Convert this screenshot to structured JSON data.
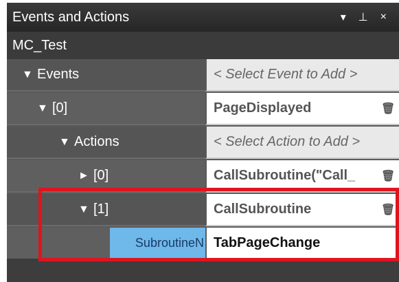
{
  "panel": {
    "title": "Events and Actions",
    "title_buttons": {
      "dropdown": "▾",
      "pin": "⊥",
      "close": "×"
    },
    "subtitle": "MC_Test"
  },
  "tree": {
    "events": {
      "label": "Events",
      "value": "< Select Event to Add >"
    },
    "event0": {
      "label": "[0]",
      "value": "PageDisplayed"
    },
    "actions": {
      "label": "Actions",
      "value": "< Select Action to Add >"
    },
    "action0": {
      "label": "[0]",
      "value": "CallSubroutine(\"Call_"
    },
    "action1": {
      "label": "[1]",
      "value": "CallSubroutine"
    },
    "subroutine": {
      "label": "SubroutineN",
      "value": "TabPageChange"
    }
  },
  "icons": {
    "expanded": "▼",
    "collapsed": "►",
    "delete": "🗑",
    "dropdown": "▾"
  },
  "colors": {
    "highlight": "#e0141e",
    "selected_label_bg": "#6fb8ea"
  }
}
